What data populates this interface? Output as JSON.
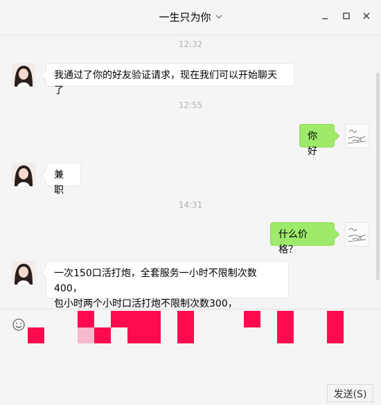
{
  "window": {
    "title": "一生只为你",
    "min_label": "—",
    "max_label": "☐",
    "close_label": "✕"
  },
  "messages": [
    {
      "type": "time",
      "text": "12:32"
    },
    {
      "type": "received",
      "text": "我通过了你的好友验证请求，现在我们可以开始聊天了"
    },
    {
      "type": "time",
      "text": "12:55"
    },
    {
      "type": "sent",
      "text": "你好"
    },
    {
      "type": "received",
      "text": "兼职"
    },
    {
      "type": "time",
      "text": "14:31"
    },
    {
      "type": "sent",
      "text": "什么价格？"
    },
    {
      "type": "received",
      "text_line1": "一次150口活打炮，全套服务一小时不限制次数400，",
      "text_line2": "包小时两个小时口活打炮不限制次数300，"
    }
  ],
  "composer": {
    "send_label": "发送(S)"
  },
  "icons": {
    "emoji": "emoji-icon",
    "dropdown": "chevron-down-icon"
  },
  "colors": {
    "sent_bubble": "#9eea6a",
    "received_bubble": "#ffffff",
    "redaction": "#ff0a4f"
  }
}
